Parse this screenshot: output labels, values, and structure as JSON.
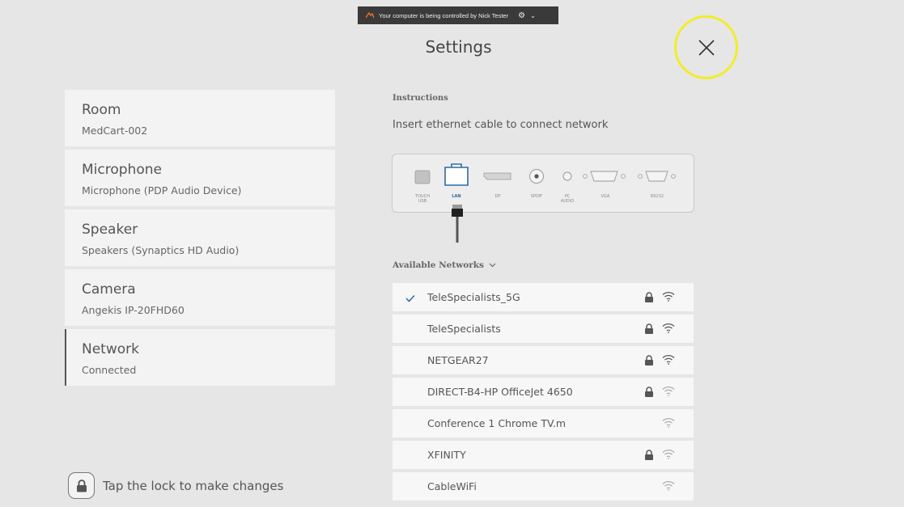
{
  "banner": {
    "text": "Your computer is being controlled by Nick Tester"
  },
  "header": {
    "title": "Settings"
  },
  "nav": {
    "items": [
      {
        "title": "Room",
        "subtitle": "MedCart-002"
      },
      {
        "title": "Microphone",
        "subtitle": "Microphone (PDP Audio Device)"
      },
      {
        "title": "Speaker",
        "subtitle": "Speakers (Synaptics HD Audio)"
      },
      {
        "title": "Camera",
        "subtitle": "Angekis IP-20FHD60"
      },
      {
        "title": "Network",
        "subtitle": "Connected"
      }
    ],
    "active": "Network"
  },
  "lock_hint": "Tap the lock to make changes",
  "instructions": {
    "label": "Instructions",
    "text": "Insert ethernet cable to connect network"
  },
  "ports": {
    "touch": "TOUCH",
    "usb": "USB",
    "lan": "LAN",
    "dp": "DP",
    "spdif": "SPDIF",
    "pc": "PC",
    "audio": "AUDIO",
    "vga": "VGA",
    "rs232": "RS232"
  },
  "available_networks": {
    "label": "Available Networks",
    "networks": [
      {
        "name": "TeleSpecialists_5G",
        "connected": true,
        "locked": true
      },
      {
        "name": "TeleSpecialists",
        "connected": false,
        "locked": true
      },
      {
        "name": "NETGEAR27",
        "connected": false,
        "locked": true
      },
      {
        "name": "DIRECT-B4-HP OfficeJet 4650",
        "connected": false,
        "locked": true
      },
      {
        "name": "Conference 1 Chrome TV.m",
        "connected": false,
        "locked": false
      },
      {
        "name": "XFINITY",
        "connected": false,
        "locked": true
      },
      {
        "name": "CableWiFi",
        "connected": false,
        "locked": false
      }
    ]
  },
  "colors": {
    "accent": "#2c6aa0",
    "highlight_ring": "#f2ec2a",
    "background": "#e6e6e6"
  }
}
